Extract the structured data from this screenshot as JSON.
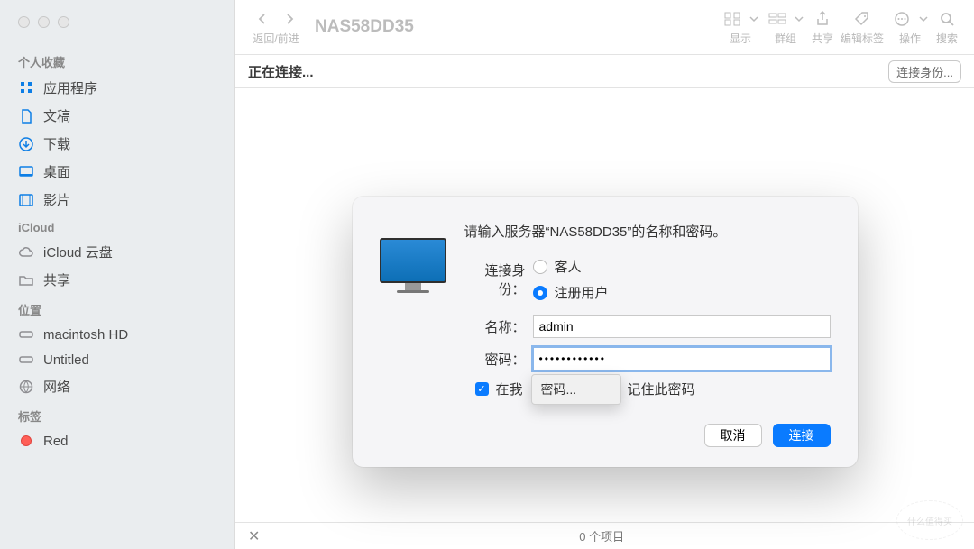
{
  "window": {
    "title": "NAS58DD35"
  },
  "toolbar": {
    "back_forward_label": "返回/前进",
    "view_label": "显示",
    "group_label": "群组",
    "share_label": "共享",
    "tags_label": "编辑标签",
    "actions_label": "操作",
    "search_label": "搜索"
  },
  "sidebar": {
    "sections": {
      "favorites": "个人收藏",
      "icloud": "iCloud",
      "locations": "位置",
      "tags": "标签"
    },
    "favorites": [
      {
        "icon": "app-grid-icon",
        "label": "应用程序"
      },
      {
        "icon": "document-icon",
        "label": "文稿"
      },
      {
        "icon": "download-icon",
        "label": "下载"
      },
      {
        "icon": "desktop-icon",
        "label": "桌面"
      },
      {
        "icon": "movie-icon",
        "label": "影片"
      }
    ],
    "icloud": [
      {
        "icon": "cloud-icon",
        "label": "iCloud 云盘"
      },
      {
        "icon": "folder-shared-icon",
        "label": "共享"
      }
    ],
    "locations": [
      {
        "icon": "disk-icon",
        "label": "macintosh HD"
      },
      {
        "icon": "disk-icon",
        "label": "Untitled"
      },
      {
        "icon": "globe-icon",
        "label": "网络"
      }
    ],
    "tag_items": [
      {
        "color": "#ff5f57",
        "label": "Red"
      }
    ]
  },
  "subbar": {
    "status": "正在连接...",
    "connect_as": "连接身份..."
  },
  "dialog": {
    "prompt": "请输入服务器“NAS58DD35”的名称和密码。",
    "connect_as_label": "连接身份：",
    "radio_guest": "客人",
    "radio_registered": "注册用户",
    "radio_selected": "registered",
    "name_label": "名称：",
    "name_value": "admin",
    "password_label": "密码：",
    "password_value": "••••••••••••",
    "remember_label_before": "在我",
    "remember_label_after": "记住此密码",
    "autocomplete_hint": "密码...",
    "remember_checked": true,
    "cancel": "取消",
    "connect": "连接"
  },
  "statusbar": {
    "items": "0 个项目"
  },
  "watermark": "什么值得买"
}
